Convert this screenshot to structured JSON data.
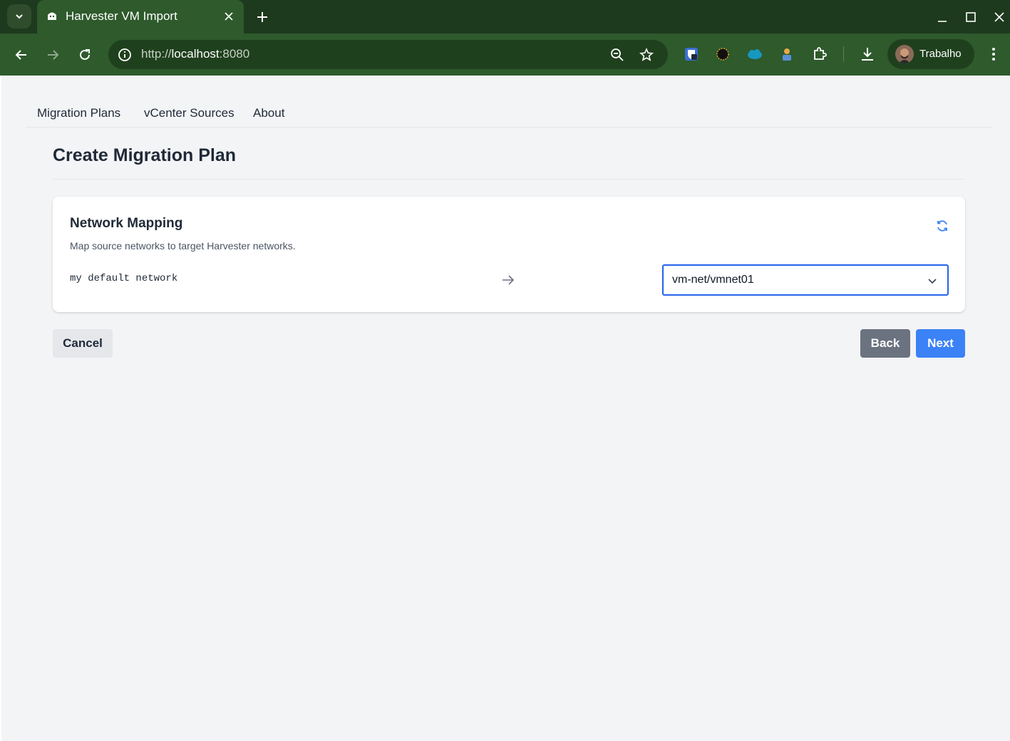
{
  "browser": {
    "tab_title": "Harvester VM Import",
    "url_scheme": "http://",
    "url_host": "localhost",
    "url_port": ":8080",
    "profile_name": "Trabalho",
    "chrome_color": "#2e5a2c"
  },
  "nav": {
    "items": [
      {
        "label": "Migration Plans"
      },
      {
        "label": "vCenter Sources"
      },
      {
        "label": "About"
      }
    ]
  },
  "page": {
    "title": "Create Migration Plan"
  },
  "network_mapping": {
    "title": "Network Mapping",
    "description": "Map source networks to target Harvester networks.",
    "rows": [
      {
        "source": "my default network",
        "target": "vm-net/vmnet01"
      }
    ]
  },
  "actions": {
    "cancel_label": "Cancel",
    "back_label": "Back",
    "next_label": "Next",
    "primary_color": "#3b82f6",
    "secondary_color": "#6b7280"
  }
}
